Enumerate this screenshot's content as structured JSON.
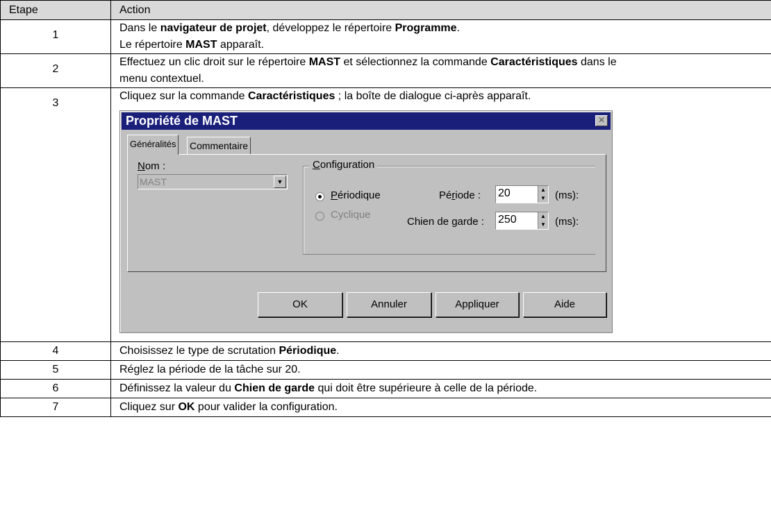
{
  "table": {
    "headers": [
      "Etape",
      "Action"
    ],
    "rows": [
      {
        "num": "1",
        "lines": [
          [
            {
              "t": "Dans le "
            },
            {
              "t": "navigateur de projet",
              "b": true
            },
            {
              "t": ", développez le répertoire "
            },
            {
              "t": "Programme",
              "b": true
            },
            {
              "t": "."
            }
          ],
          [
            {
              "t": "Le répertoire "
            },
            {
              "t": "MAST",
              "b": true
            },
            {
              "t": " apparaît."
            }
          ]
        ]
      },
      {
        "num": "2",
        "lines": [
          [
            {
              "t": "Effectuez un clic droit sur le répertoire "
            },
            {
              "t": "MAST",
              "b": true
            },
            {
              "t": " et sélectionnez la commande "
            },
            {
              "t": "Caractéristiques",
              "b": true
            },
            {
              "t": " dans le"
            }
          ],
          [
            {
              "t": "menu contextuel."
            }
          ]
        ]
      },
      {
        "num": "3",
        "lines": [
          [
            {
              "t": "Cliquez sur la commande "
            },
            {
              "t": "Caractéristiques",
              "b": true
            },
            {
              "t": " ; la boîte de dialogue ci-après apparaît."
            }
          ]
        ]
      },
      {
        "num": "4",
        "lines": [
          [
            {
              "t": "Choisissez le type de scrutation "
            },
            {
              "t": "Périodique",
              "b": true
            },
            {
              "t": "."
            }
          ]
        ]
      },
      {
        "num": "5",
        "lines": [
          [
            {
              "t": "Réglez la période de la tâche sur 20."
            }
          ]
        ]
      },
      {
        "num": "6",
        "lines": [
          [
            {
              "t": "Définissez la valeur du "
            },
            {
              "t": "Chien de garde",
              "b": true
            },
            {
              "t": " qui doit être supérieure à celle de la période."
            }
          ]
        ]
      },
      {
        "num": "7",
        "lines": [
          [
            {
              "t": "Cliquez sur "
            },
            {
              "t": "OK",
              "b": true
            },
            {
              "t": " pour valider la configuration."
            }
          ]
        ]
      }
    ]
  },
  "dialog": {
    "title": "Propriété de MAST",
    "close_glyph": "✕",
    "tabs": [
      "Généralités",
      "Commentaire"
    ],
    "name_label": "Nom :",
    "name_value": "MAST",
    "combo_arrow": "▼",
    "group_label": "Configuration",
    "periodic_label": "Périodique",
    "cyclic_label": "Cyclique",
    "period_label": "Période :",
    "period_value": "20",
    "watchdog_label": "Chien de garde :",
    "watchdog_value": "250",
    "unit_ms": "(ms):",
    "spin_glyph": "▲\n▼",
    "buttons": {
      "ok": "OK",
      "cancel": "Annuler",
      "apply": "Appliquer",
      "help": "Aide"
    }
  }
}
